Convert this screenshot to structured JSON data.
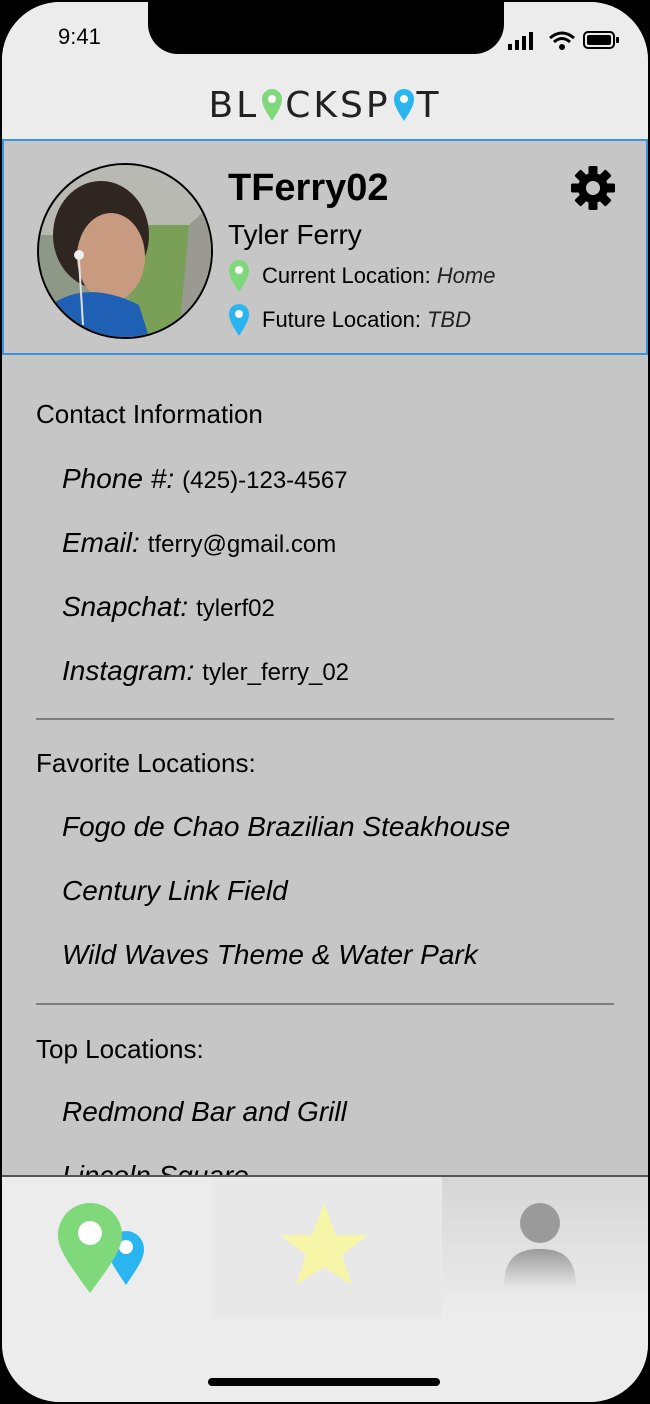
{
  "status": {
    "time": "9:41",
    "icons": [
      "signal-icon",
      "wifi-icon",
      "battery-icon"
    ]
  },
  "brand": {
    "prefix": "BL",
    "middle": "CKSP",
    "suffix": "T"
  },
  "profile": {
    "username": "TFerry02",
    "full_name": "Tyler Ferry",
    "current_location_label": "Current Location:",
    "current_location_value": "Home",
    "future_location_label": "Future Location:",
    "future_location_value": "TBD"
  },
  "contact": {
    "title": "Contact Information",
    "phone_label": "Phone #:",
    "phone_value": "(425)-123-4567",
    "email_label": "Email:",
    "email_value": "tferry@gmail.com",
    "snapchat_label": "Snapchat:",
    "snapchat_value": "tylerf02",
    "instagram_label": "Instagram:",
    "instagram_value": "tyler_ferry_02"
  },
  "favorites": {
    "title": "Favorite Locations:",
    "items": [
      "Fogo de Chao Brazilian Steakhouse",
      "Century Link Field",
      "Wild Waves Theme & Water Park"
    ]
  },
  "top": {
    "title": "Top Locations:",
    "items": [
      "Redmond Bar and Grill",
      "Lincoln Square"
    ]
  },
  "colors": {
    "accent_blue": "#3a93e0",
    "pin_green": "#7fd87a",
    "pin_blue": "#29b6f0",
    "star_yellow": "#f7f5a8"
  }
}
